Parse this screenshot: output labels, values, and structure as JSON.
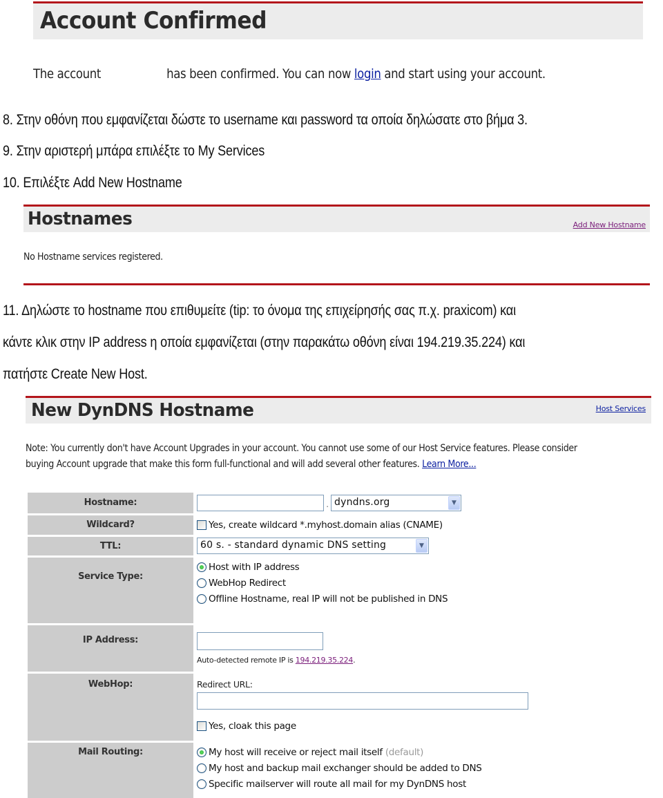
{
  "account_confirmed": {
    "title": "Account Confirmed",
    "message_prefix": "The account",
    "message_middle": "has been confirmed. You can now",
    "login_link": "login",
    "message_suffix": "and start using your account."
  },
  "steps_a": [
    "8.  Στην οθόνη που εμφανίζεται δώστε το username και password τα οποία δηλώσατε στο βήμα 3.",
    "9.  Στην αριστερή μπάρα επιλέξτε το My Services",
    "10. Επιλέξτε Add New Hostname"
  ],
  "hostnames": {
    "title": "Hostnames",
    "add_link": "Add New Hostname",
    "empty_message": "No Hostname services registered."
  },
  "steps_b": [
    "11. Δηλώστε το hostname που επιθυμείτε (tip: το όνομα της επιχείρησής σας π.χ. praxicom) και",
    "κάντε κλικ στην IP address η οποία εμφανίζεται (στην παρακάτω οθόνη είναι 194.219.35.224) και",
    "πατήστε Create New Host."
  ],
  "new_hostname": {
    "title": "New DynDNS Hostname",
    "host_services_link": "Host Services",
    "note_line1": "Note: You currently don't have Account Upgrades in your account. You cannot use some of our Host Service features. Please consider",
    "note_line2": "buying Account upgrade that make this form full-functional and will add several other features.",
    "learn_more_link": "Learn More...",
    "form": {
      "hostname": {
        "label": "Hostname:",
        "value": "",
        "separator": ".",
        "domain_selected": "dyndns.org"
      },
      "wildcard": {
        "label": "Wildcard?",
        "checkbox_label": "Yes, create wildcard *.myhost.domain alias (CNAME)",
        "checked": false
      },
      "ttl": {
        "label": "TTL:",
        "selected": "60 s. - standard dynamic DNS setting"
      },
      "service_type": {
        "label": "Service Type:",
        "options": [
          {
            "label": "Host with IP address",
            "checked": true
          },
          {
            "label": "WebHop Redirect",
            "checked": false
          },
          {
            "label": "Offline Hostname, real IP will not be published in DNS",
            "checked": false
          }
        ]
      },
      "ip_address": {
        "label": "IP Address:",
        "value": "",
        "auto_detected_prefix": "Auto-detected remote IP is",
        "auto_detected_ip": "194.219.35.224",
        "auto_detected_suffix": "."
      },
      "webhop": {
        "label": "WebHop:",
        "redirect_label": "Redirect URL:",
        "redirect_value": "",
        "cloak_label": "Yes, cloak this page",
        "cloak_checked": false
      },
      "mail_routing": {
        "label": "Mail Routing:",
        "options": [
          {
            "label": "My host will receive or reject mail itself",
            "suffix": "(default)",
            "checked": true
          },
          {
            "label": "My host and backup mail exchanger should be added to DNS",
            "checked": false
          },
          {
            "label": "Specific mailserver will route all mail for my DynDNS host",
            "checked": false
          }
        ]
      }
    }
  },
  "colors": {
    "banner_rule": "#b3151b",
    "banner_bg": "#ececec",
    "label_bg": "#cccccc",
    "link": "#0b1fa0",
    "visited_link": "#7a1d7a",
    "radio_selected": "#21a12b"
  }
}
